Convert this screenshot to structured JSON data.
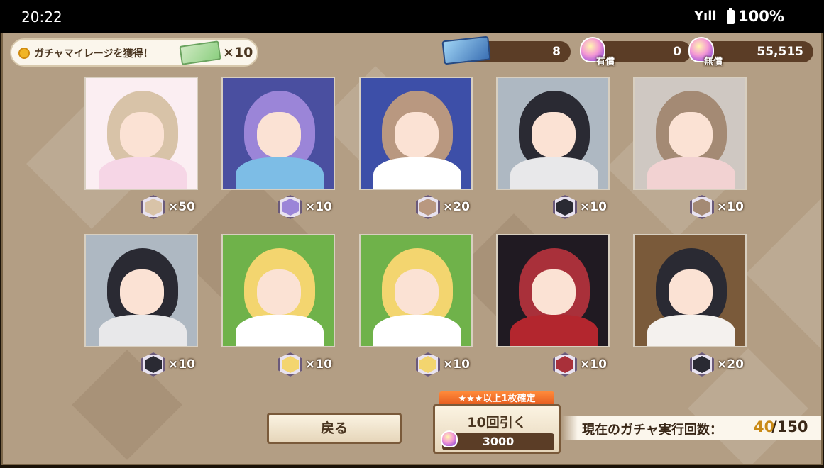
{
  "status_bar": {
    "time": "20:22",
    "signal": "Yıll",
    "battery": "100%"
  },
  "mileage": {
    "text": "ガチャマイレージを獲得！",
    "count": "×10"
  },
  "currency": {
    "tickets": "8",
    "paid_label": "有償",
    "paid": "0",
    "free_label": "無償",
    "free": "55,515"
  },
  "results": [
    {
      "count": "×50",
      "hair": "#d8c3a8",
      "body": "#f6d6e6",
      "bg": "#fbeef2"
    },
    {
      "count": "×10",
      "hair": "#9b85d8",
      "body": "#7dbde6",
      "bg": "#4a4fa0"
    },
    {
      "count": "×20",
      "hair": "#b99880",
      "body": "#ffffff",
      "bg": "#3d4fa8"
    },
    {
      "count": "×10",
      "hair": "#2a2a33",
      "body": "#e8e8ea",
      "bg": "#aeb8c2"
    },
    {
      "count": "×10",
      "hair": "#a48a74",
      "body": "#f2d2d2",
      "bg": "#cfc8c2"
    },
    {
      "count": "×10",
      "hair": "#2a2a33",
      "body": "#e8e8ea",
      "bg": "#aeb8c2"
    },
    {
      "count": "×10",
      "hair": "#f3d56f",
      "body": "#ffffff",
      "bg": "#6fb24a"
    },
    {
      "count": "×10",
      "hair": "#f3d56f",
      "body": "#ffffff",
      "bg": "#6fb24a"
    },
    {
      "count": "×10",
      "hair": "#a9303a",
      "body": "#b3262e",
      "bg": "#201a22"
    },
    {
      "count": "×20",
      "hair": "#2a2a33",
      "body": "#f4f1ee",
      "bg": "#7a5a3a"
    }
  ],
  "buttons": {
    "back": "戻る",
    "pull_badge": "★★★以上1枚確定",
    "pull": "10回引く",
    "pull_cost": "3000"
  },
  "gacha_count": {
    "label": "現在のガチャ実行回数：",
    "current": "40",
    "max": "/150"
  }
}
